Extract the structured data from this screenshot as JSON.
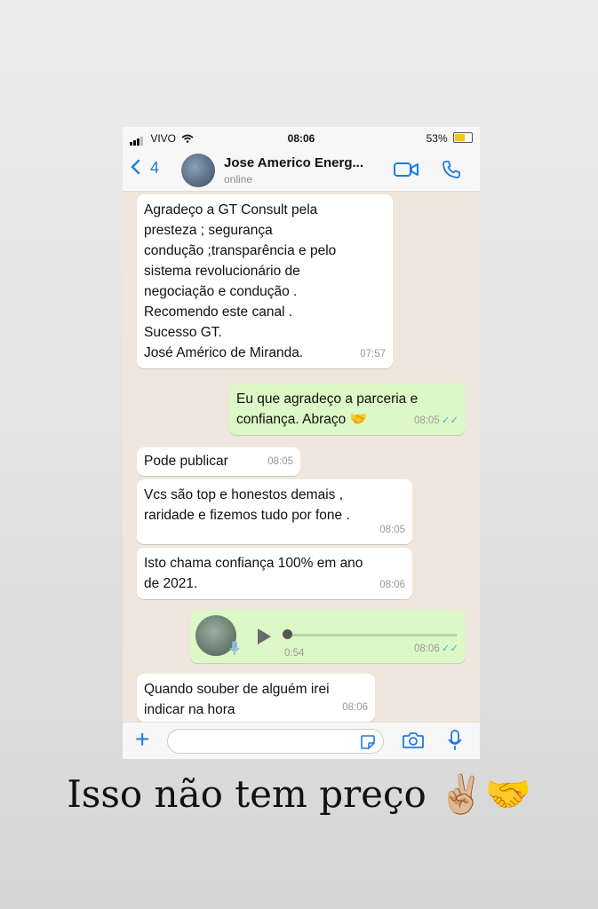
{
  "status_bar": {
    "carrier": "VIVO",
    "time": "08:06",
    "battery": "53%"
  },
  "header": {
    "back_count": "4",
    "contact_name": "Jose Americo  Energ...",
    "contact_status": "online"
  },
  "messages": [
    {
      "direction": "in",
      "text": "Agradeço a GT Consult pela\npresteza ; segurança\ncondução ;transparência e pelo\nsistema revolucionário de\nnegociação e condução .\nRecomendo este canal .\nSucesso GT.\nJosé Américo de Miranda.",
      "time": "07:57"
    },
    {
      "direction": "out",
      "text": "Eu que agradeço a parceria e\nconfiança. Abraço 🤝",
      "time": "08:05",
      "ticks": "✓✓"
    },
    {
      "direction": "in",
      "text": "Pode publicar",
      "time": "08:05"
    },
    {
      "direction": "in",
      "text": "Vcs são top e honestos demais ,\nraridade e fizemos tudo por fone .",
      "time": "08:05"
    },
    {
      "direction": "in",
      "text": "Isto chama confiança 100% em ano\nde 2021.",
      "time": "08:06"
    },
    {
      "direction": "out",
      "type": "voice",
      "duration": "0:54",
      "time": "08:06",
      "ticks": "✓✓"
    },
    {
      "direction": "in",
      "text": "Quando souber de alguém irei\nindicar na hora",
      "time": "08:06"
    }
  ],
  "input": {
    "plus_label": "+"
  },
  "caption": "Isso não tem preço ✌🏼🤝",
  "colors": {
    "accent": "#1f7ae0",
    "outgoing_bubble": "#dcf8c6",
    "chat_bg": "#efe7dd",
    "read_ticks": "#4fa6e8"
  },
  "icons": [
    "signal-icon",
    "wifi-icon",
    "battery-icon",
    "back-chevron-icon",
    "video-call-icon",
    "phone-call-icon",
    "play-icon",
    "mic-icon",
    "sticker-icon",
    "camera-icon"
  ]
}
